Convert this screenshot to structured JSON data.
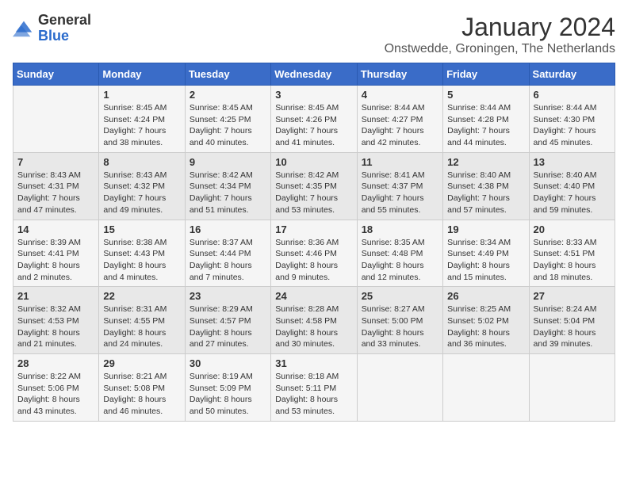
{
  "header": {
    "logo_line1": "General",
    "logo_line2": "Blue",
    "calendar_title": "January 2024",
    "calendar_subtitle": "Onstwedde, Groningen, The Netherlands"
  },
  "weekdays": [
    "Sunday",
    "Monday",
    "Tuesday",
    "Wednesday",
    "Thursday",
    "Friday",
    "Saturday"
  ],
  "weeks": [
    [
      {
        "day": "",
        "sunrise": "",
        "sunset": "",
        "daylight": ""
      },
      {
        "day": "1",
        "sunrise": "Sunrise: 8:45 AM",
        "sunset": "Sunset: 4:24 PM",
        "daylight": "Daylight: 7 hours and 38 minutes."
      },
      {
        "day": "2",
        "sunrise": "Sunrise: 8:45 AM",
        "sunset": "Sunset: 4:25 PM",
        "daylight": "Daylight: 7 hours and 40 minutes."
      },
      {
        "day": "3",
        "sunrise": "Sunrise: 8:45 AM",
        "sunset": "Sunset: 4:26 PM",
        "daylight": "Daylight: 7 hours and 41 minutes."
      },
      {
        "day": "4",
        "sunrise": "Sunrise: 8:44 AM",
        "sunset": "Sunset: 4:27 PM",
        "daylight": "Daylight: 7 hours and 42 minutes."
      },
      {
        "day": "5",
        "sunrise": "Sunrise: 8:44 AM",
        "sunset": "Sunset: 4:28 PM",
        "daylight": "Daylight: 7 hours and 44 minutes."
      },
      {
        "day": "6",
        "sunrise": "Sunrise: 8:44 AM",
        "sunset": "Sunset: 4:30 PM",
        "daylight": "Daylight: 7 hours and 45 minutes."
      }
    ],
    [
      {
        "day": "7",
        "sunrise": "Sunrise: 8:43 AM",
        "sunset": "Sunset: 4:31 PM",
        "daylight": "Daylight: 7 hours and 47 minutes."
      },
      {
        "day": "8",
        "sunrise": "Sunrise: 8:43 AM",
        "sunset": "Sunset: 4:32 PM",
        "daylight": "Daylight: 7 hours and 49 minutes."
      },
      {
        "day": "9",
        "sunrise": "Sunrise: 8:42 AM",
        "sunset": "Sunset: 4:34 PM",
        "daylight": "Daylight: 7 hours and 51 minutes."
      },
      {
        "day": "10",
        "sunrise": "Sunrise: 8:42 AM",
        "sunset": "Sunset: 4:35 PM",
        "daylight": "Daylight: 7 hours and 53 minutes."
      },
      {
        "day": "11",
        "sunrise": "Sunrise: 8:41 AM",
        "sunset": "Sunset: 4:37 PM",
        "daylight": "Daylight: 7 hours and 55 minutes."
      },
      {
        "day": "12",
        "sunrise": "Sunrise: 8:40 AM",
        "sunset": "Sunset: 4:38 PM",
        "daylight": "Daylight: 7 hours and 57 minutes."
      },
      {
        "day": "13",
        "sunrise": "Sunrise: 8:40 AM",
        "sunset": "Sunset: 4:40 PM",
        "daylight": "Daylight: 7 hours and 59 minutes."
      }
    ],
    [
      {
        "day": "14",
        "sunrise": "Sunrise: 8:39 AM",
        "sunset": "Sunset: 4:41 PM",
        "daylight": "Daylight: 8 hours and 2 minutes."
      },
      {
        "day": "15",
        "sunrise": "Sunrise: 8:38 AM",
        "sunset": "Sunset: 4:43 PM",
        "daylight": "Daylight: 8 hours and 4 minutes."
      },
      {
        "day": "16",
        "sunrise": "Sunrise: 8:37 AM",
        "sunset": "Sunset: 4:44 PM",
        "daylight": "Daylight: 8 hours and 7 minutes."
      },
      {
        "day": "17",
        "sunrise": "Sunrise: 8:36 AM",
        "sunset": "Sunset: 4:46 PM",
        "daylight": "Daylight: 8 hours and 9 minutes."
      },
      {
        "day": "18",
        "sunrise": "Sunrise: 8:35 AM",
        "sunset": "Sunset: 4:48 PM",
        "daylight": "Daylight: 8 hours and 12 minutes."
      },
      {
        "day": "19",
        "sunrise": "Sunrise: 8:34 AM",
        "sunset": "Sunset: 4:49 PM",
        "daylight": "Daylight: 8 hours and 15 minutes."
      },
      {
        "day": "20",
        "sunrise": "Sunrise: 8:33 AM",
        "sunset": "Sunset: 4:51 PM",
        "daylight": "Daylight: 8 hours and 18 minutes."
      }
    ],
    [
      {
        "day": "21",
        "sunrise": "Sunrise: 8:32 AM",
        "sunset": "Sunset: 4:53 PM",
        "daylight": "Daylight: 8 hours and 21 minutes."
      },
      {
        "day": "22",
        "sunrise": "Sunrise: 8:31 AM",
        "sunset": "Sunset: 4:55 PM",
        "daylight": "Daylight: 8 hours and 24 minutes."
      },
      {
        "day": "23",
        "sunrise": "Sunrise: 8:29 AM",
        "sunset": "Sunset: 4:57 PM",
        "daylight": "Daylight: 8 hours and 27 minutes."
      },
      {
        "day": "24",
        "sunrise": "Sunrise: 8:28 AM",
        "sunset": "Sunset: 4:58 PM",
        "daylight": "Daylight: 8 hours and 30 minutes."
      },
      {
        "day": "25",
        "sunrise": "Sunrise: 8:27 AM",
        "sunset": "Sunset: 5:00 PM",
        "daylight": "Daylight: 8 hours and 33 minutes."
      },
      {
        "day": "26",
        "sunrise": "Sunrise: 8:25 AM",
        "sunset": "Sunset: 5:02 PM",
        "daylight": "Daylight: 8 hours and 36 minutes."
      },
      {
        "day": "27",
        "sunrise": "Sunrise: 8:24 AM",
        "sunset": "Sunset: 5:04 PM",
        "daylight": "Daylight: 8 hours and 39 minutes."
      }
    ],
    [
      {
        "day": "28",
        "sunrise": "Sunrise: 8:22 AM",
        "sunset": "Sunset: 5:06 PM",
        "daylight": "Daylight: 8 hours and 43 minutes."
      },
      {
        "day": "29",
        "sunrise": "Sunrise: 8:21 AM",
        "sunset": "Sunset: 5:08 PM",
        "daylight": "Daylight: 8 hours and 46 minutes."
      },
      {
        "day": "30",
        "sunrise": "Sunrise: 8:19 AM",
        "sunset": "Sunset: 5:09 PM",
        "daylight": "Daylight: 8 hours and 50 minutes."
      },
      {
        "day": "31",
        "sunrise": "Sunrise: 8:18 AM",
        "sunset": "Sunset: 5:11 PM",
        "daylight": "Daylight: 8 hours and 53 minutes."
      },
      {
        "day": "",
        "sunrise": "",
        "sunset": "",
        "daylight": ""
      },
      {
        "day": "",
        "sunrise": "",
        "sunset": "",
        "daylight": ""
      },
      {
        "day": "",
        "sunrise": "",
        "sunset": "",
        "daylight": ""
      }
    ]
  ]
}
